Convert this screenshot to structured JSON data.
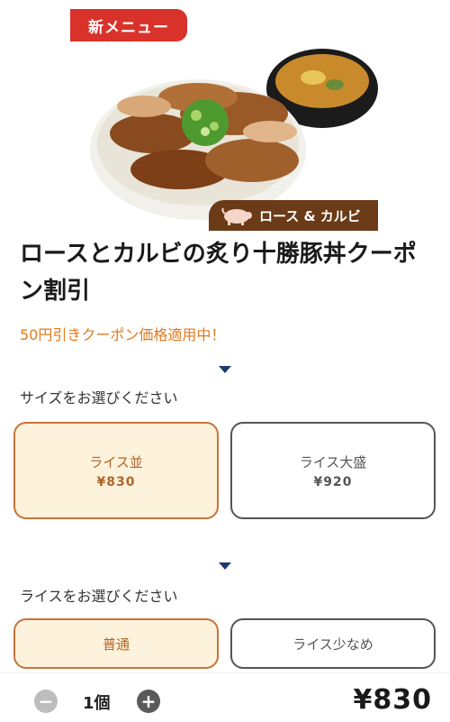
{
  "hero": {
    "badge": "新メニュー",
    "tag": "ロース & カルビ"
  },
  "product": {
    "title": "ロースとカルビの炙り十勝豚丼クーポン割引",
    "promo": "50円引きクーポン価格適用中！"
  },
  "size_section": {
    "label": "サイズをお選びください",
    "options": [
      {
        "name": "ライス並",
        "price": "¥830",
        "selected": true
      },
      {
        "name": "ライス大盛",
        "price": "¥920",
        "selected": false
      }
    ]
  },
  "rice_section": {
    "label": "ライスをお選びください",
    "options": [
      {
        "name": "普通",
        "selected": true
      },
      {
        "name": "ライス少なめ",
        "selected": false
      }
    ]
  },
  "footer": {
    "minus": "−",
    "plus": "+",
    "quantity": "1個",
    "total": "¥830"
  },
  "colors": {
    "accent": "#c8733a",
    "selected_bg": "#fdf2dc",
    "promo": "#e07a1f",
    "badge_red": "#d9322a",
    "tag_brown": "#6b3a17"
  }
}
